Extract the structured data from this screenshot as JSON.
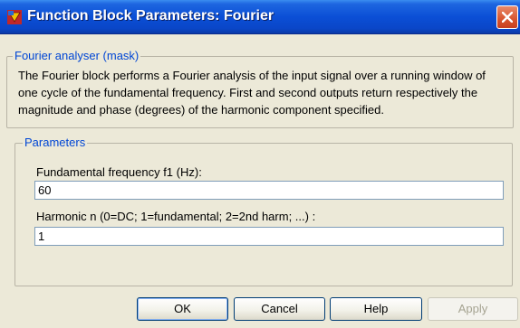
{
  "window": {
    "title": "Function Block Parameters: Fourier",
    "app_icon": "simulink-block-icon",
    "close_icon": "close-icon",
    "accent_color": "#0a46c8",
    "close_color": "#d8542e"
  },
  "mask_group": {
    "title": "Fourier analyser (mask)",
    "description": "The Fourier block performs a Fourier analysis of the input signal over a running window of one cycle of the fundamental frequency. First and second outputs return respectively the magnitude and phase (degrees) of the harmonic component specified."
  },
  "parameters_group": {
    "title": "Parameters",
    "fields": [
      {
        "label": "Fundamental frequency f1 (Hz):",
        "value": "60"
      },
      {
        "label": "Harmonic n (0=DC; 1=fundamental; 2=2nd harm;  ...) :",
        "value": "1"
      }
    ]
  },
  "buttons": {
    "ok": "OK",
    "cancel": "Cancel",
    "help": "Help",
    "apply": "Apply"
  }
}
